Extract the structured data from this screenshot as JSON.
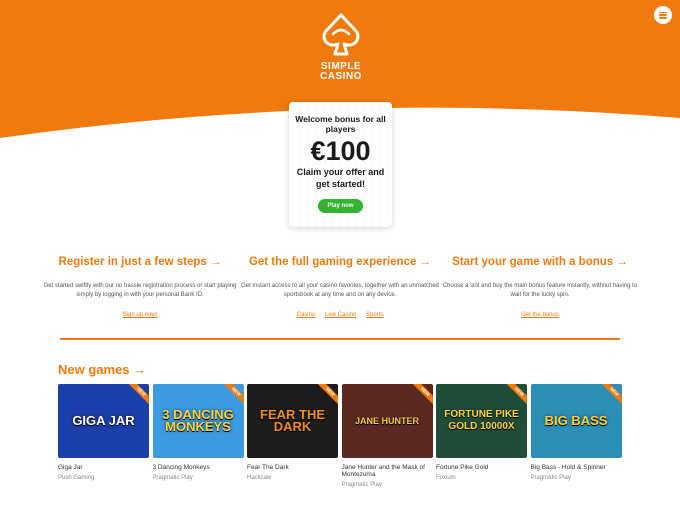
{
  "brand": {
    "logo_line1": "SIMPLE",
    "logo_line2": "CASINO",
    "accent": "#f07a0d",
    "green": "#35b22f"
  },
  "bonus": {
    "heading": "Welcome bonus for all players",
    "amount": "€100",
    "subtext": "Claim your offer and get started!",
    "button": "Play now"
  },
  "features": [
    {
      "title": "Register in just a few steps →",
      "text": "Get started swiftly with our no hassle registration process or start playing simply by logging in with your personal Bank ID.",
      "links": [
        "Sign up now!"
      ]
    },
    {
      "title": "Get the full gaming experience →",
      "text": "Get instant access to all your casino favorites, together with an unmatched sportsbook at any time and on any device.",
      "links": [
        "Casino",
        "Live Casino",
        "Sports"
      ]
    },
    {
      "title": "Start your game with a bonus →",
      "text": "Choose a slot and buy the main bonus feature instantly, without having to wait for the lucky spin.",
      "links": [
        "Get the bonus"
      ]
    }
  ],
  "new_games": {
    "title": "New games →",
    "ribbon": "NEW",
    "items": [
      {
        "name": "Giga Jar",
        "provider": "Push Gaming",
        "art": "GIGA JAR",
        "bg": "#1b3fa8"
      },
      {
        "name": "3 Dancing Monkeys",
        "provider": "Pragmatic Play",
        "art": "3 DANCING MONKEYS",
        "bg": "#3a9be0"
      },
      {
        "name": "Fear The Dark",
        "provider": "Hacksaw",
        "art": "FEAR THE DARK",
        "bg": "#1c1c1c"
      },
      {
        "name": "Jane Hunter and the Mask of Montezuma",
        "provider": "Pragmatic Play",
        "art": "JANE HUNTER",
        "bg": "#5a2a22"
      },
      {
        "name": "Fortune Pike Gold",
        "provider": "Foxium",
        "art": "FORTUNE PIKE GOLD 10000X",
        "bg": "#1f4d3a"
      },
      {
        "name": "Big Bass - Hold & Spinner",
        "provider": "Pragmatic Play",
        "art": "BIG BASS",
        "bg": "#2b8fb8"
      }
    ]
  }
}
